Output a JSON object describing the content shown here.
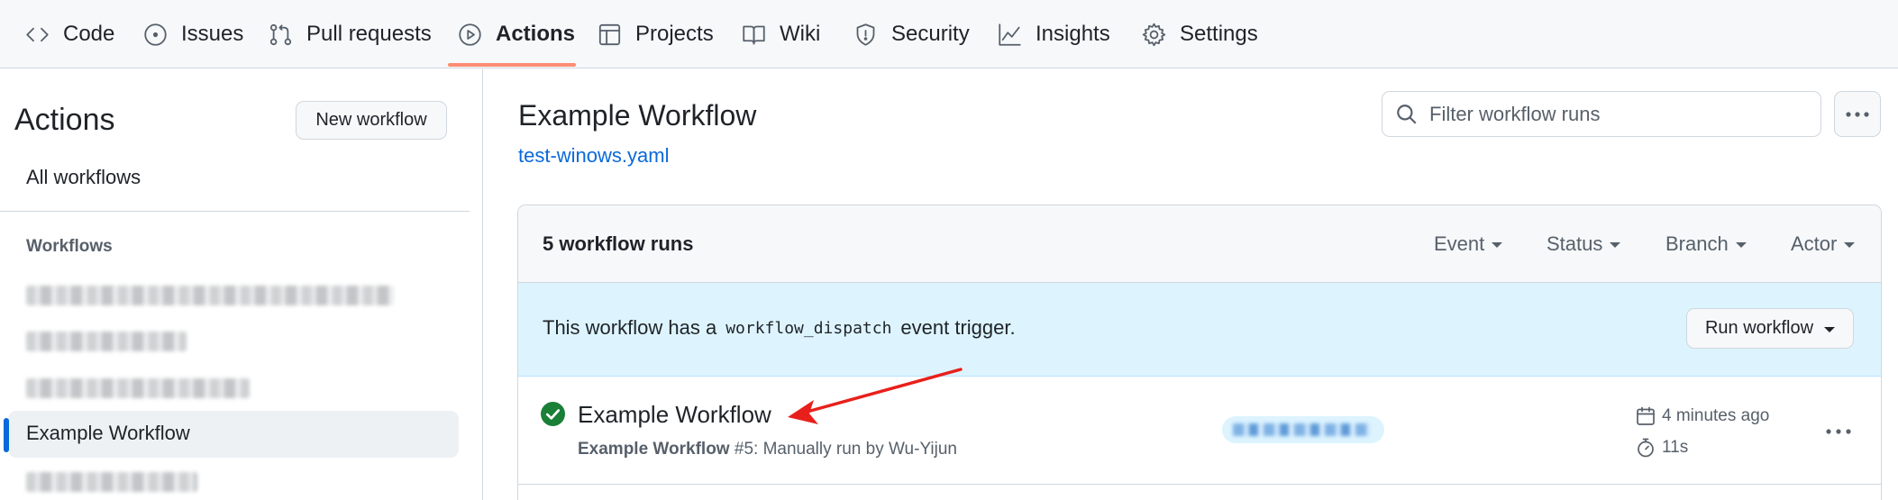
{
  "nav": {
    "tabs": [
      {
        "label": "Code",
        "icon": "code-icon"
      },
      {
        "label": "Issues",
        "icon": "issue-opened-icon"
      },
      {
        "label": "Pull requests",
        "icon": "git-pull-request-icon"
      },
      {
        "label": "Actions",
        "icon": "play-icon",
        "active": true
      },
      {
        "label": "Projects",
        "icon": "table-icon"
      },
      {
        "label": "Wiki",
        "icon": "book-icon"
      },
      {
        "label": "Security",
        "icon": "shield-icon"
      },
      {
        "label": "Insights",
        "icon": "graph-icon"
      },
      {
        "label": "Settings",
        "icon": "gear-icon"
      }
    ],
    "active_underline_color": "#fd8c73"
  },
  "sidebar": {
    "title": "Actions",
    "new_workflow_label": "New workflow",
    "all_workflows_label": "All workflows",
    "section_label": "Workflows",
    "active_item_label": "Example Workflow",
    "accent_color": "#0969da"
  },
  "main": {
    "workflow_title": "Example Workflow",
    "workflow_file": "test-winows.yaml",
    "filter_placeholder": "Filter workflow runs",
    "runs_count_label": "5 workflow runs",
    "filters": {
      "event": "Event",
      "status": "Status",
      "branch": "Branch",
      "actor": "Actor"
    },
    "dispatch": {
      "text_before": "This workflow has a",
      "code": "workflow_dispatch",
      "text_after": "event trigger.",
      "button_label": "Run workflow"
    },
    "run": {
      "title": "Example Workflow",
      "sub_workflow": "Example Workflow",
      "sub_detail": "#5: Manually run by Wu-Yijun",
      "time_ago": "4 minutes ago",
      "duration": "11s",
      "status": "success",
      "status_color": "#1a7f37"
    }
  }
}
